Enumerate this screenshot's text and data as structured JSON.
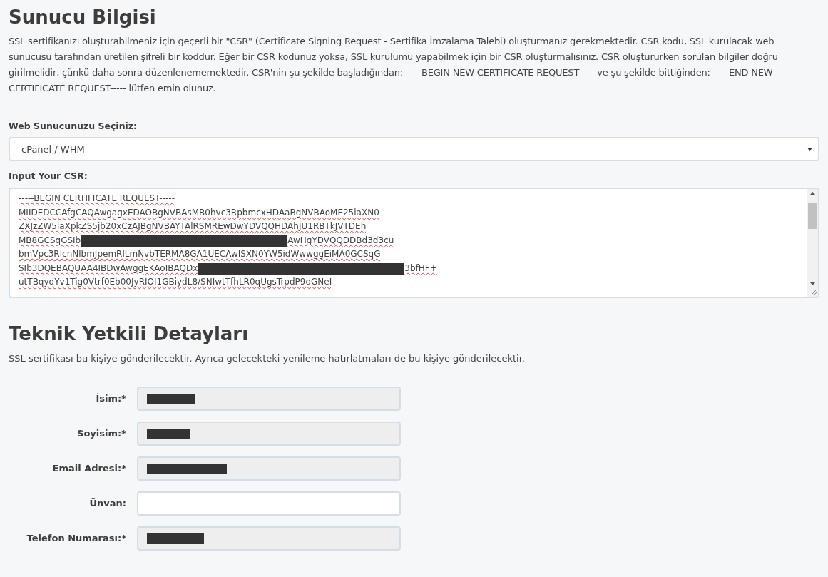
{
  "server_section": {
    "title": "Sunucu Bilgisi",
    "description": "SSL sertifikanızı oluşturabilmeniz için geçerli bir \"CSR\" (Certificate Signing Request - Sertifika İmzalama Talebi) oluşturmanız gerekmektedir. CSR kodu, SSL kurulacak web sunucusu tarafından üretilen şifreli bir koddur. Eğer bir CSR kodunuz yoksa, SSL kurulumu yapabilmek için bir CSR oluşturmalısınız. CSR oluştururken sorulan bilgiler doğru girilmelidir, çünkü daha sonra düzenlenememektedir. CSR'nin şu şekilde başladığından: -----BEGIN NEW CERTIFICATE REQUEST----- ve şu şekilde bittiğinden: -----END NEW CERTIFICATE REQUEST----- lütfen emin olunuz.",
    "server_select": {
      "label": "Web Sunucunuzu Seçiniz:",
      "value": "cPanel / WHM"
    },
    "csr": {
      "label": "Input Your CSR:",
      "lines": [
        [
          {
            "kind": "text",
            "text": "-----BEGIN CERTIFICATE REQUEST-----"
          }
        ],
        [
          {
            "kind": "text",
            "text": "MIIDEDCCAfgCAQAwgagxEDAOBgNVBAsMB0hvc3RpbmcxHDAaBgNVBAoME25laXN0"
          }
        ],
        [
          {
            "kind": "text",
            "text": "ZXJzZW5iaXpkZS5jb20xCzAJBgNVBAYTAlRSMREwDwYDVQQHDAhJU1RBTkJVTDEh"
          }
        ],
        [
          {
            "kind": "text",
            "text": "MB8GCSqGSIb"
          },
          {
            "kind": "redacted"
          },
          {
            "kind": "text",
            "text": "AwHgYDVQQDDBd3d3cu"
          }
        ],
        [
          {
            "kind": "text",
            "text": "bmVpc3RlcnNlbmJpemRlLmNvbTERMA8GA1UECAwISXN0YW5idWwwggEiMA0GCSqG"
          }
        ],
        [
          {
            "kind": "text",
            "text": "SIb3DQEBAQUAA4IBDwAwggEKAoIBAQDx"
          },
          {
            "kind": "redacted"
          },
          {
            "kind": "text",
            "text": "3bfHF+"
          }
        ],
        [
          {
            "kind": "text",
            "text": "utTBqydYv1Tig0Vtrf0Eb00JyRIOI1GBiydL8/SNIwtTfhLR0qUgsTrpdP9dGNeI"
          }
        ]
      ]
    }
  },
  "contact_section": {
    "title": "Teknik Yetkili Detayları",
    "description": "SSL sertifikası bu kişiye gönderilecektir. Ayrıca gelecekteki yenileme hatırlatmaları de bu kişiye gönderilecektir.",
    "fields": [
      {
        "label": "İsim:*",
        "disabled": true,
        "redacted": true
      },
      {
        "label": "Soyisim:*",
        "disabled": true,
        "redacted": true
      },
      {
        "label": "Email Adresi:*",
        "disabled": true,
        "redacted": true
      },
      {
        "label": "Ünvan:",
        "disabled": false,
        "redacted": false
      },
      {
        "label": "Telefon Numarası:*",
        "disabled": true,
        "redacted": true
      }
    ]
  }
}
